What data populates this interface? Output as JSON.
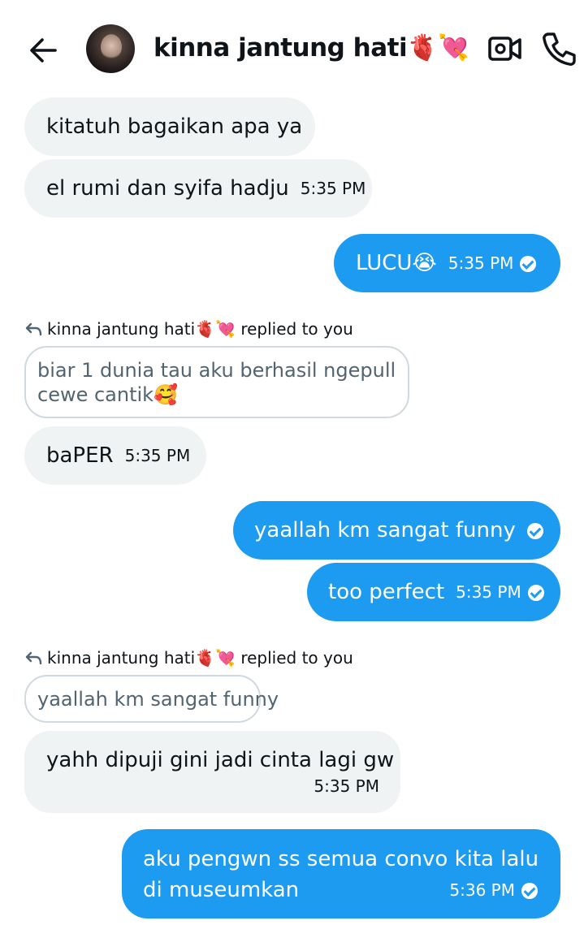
{
  "header": {
    "contact_name": "kinna jantung hati🫀💘"
  },
  "messages": {
    "m1": {
      "text": "kitatuh bagaikan apa ya"
    },
    "m2": {
      "text": "el rumi dan syifa hadju",
      "time": "5:35 PM"
    },
    "m3": {
      "text": "LUCU😭",
      "time": "5:35 PM"
    },
    "reply1": {
      "label": "kinna jantung hati🫀💘 replied to you",
      "quote_line1": "biar 1 dunia tau aku berhasil ngepull",
      "quote_line2": "cewe cantik🥰"
    },
    "m4": {
      "text": "baPER",
      "time": "5:35 PM"
    },
    "m5": {
      "text": "yaallah km sangat funny"
    },
    "m6": {
      "text": "too perfect",
      "time": "5:35 PM"
    },
    "reply2": {
      "label": "kinna jantung hati🫀💘 replied to you",
      "quote": "yaallah km sangat funny"
    },
    "m7": {
      "text": "yahh dipuji gini jadi cinta lagi gw",
      "time": "5:35 PM"
    },
    "m8": {
      "line1": "aku pengwn ss semua convo kita lalu",
      "line2": "di museumkan",
      "time": "5:36 PM"
    }
  },
  "colors": {
    "outgoing_bubble": "#1d9bf0",
    "incoming_bubble": "#eff3f4"
  },
  "icons": [
    "back-arrow-icon",
    "video-call-icon",
    "phone-icon",
    "reply-arrow-icon",
    "read-check-icon"
  ]
}
